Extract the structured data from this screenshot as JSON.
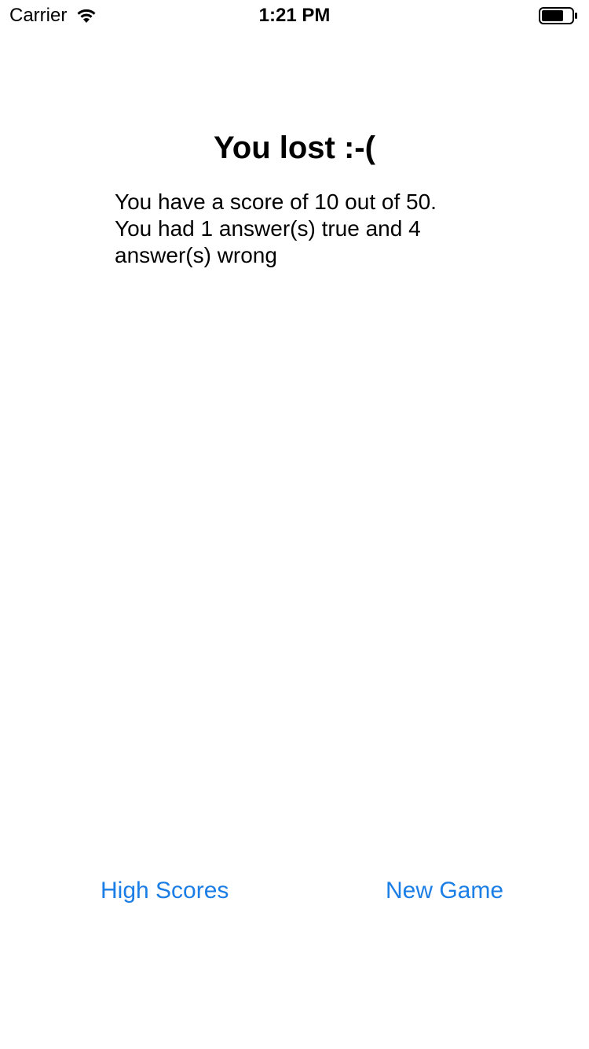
{
  "status_bar": {
    "carrier": "Carrier",
    "time": "1:21 PM",
    "wifi_icon": "wifi-icon",
    "battery_icon": "battery-icon"
  },
  "result": {
    "title": "You lost :-(",
    "message_lines": [
      "You have a score of 10 out of 50.",
      "You had 1 answer(s) true and 4",
      "answer(s) wrong"
    ]
  },
  "buttons": {
    "high_scores_label": "High Scores",
    "new_game_label": "New Game"
  },
  "colors": {
    "accent": "#1a7ee6",
    "background": "#ffffff",
    "text": "#000000"
  }
}
